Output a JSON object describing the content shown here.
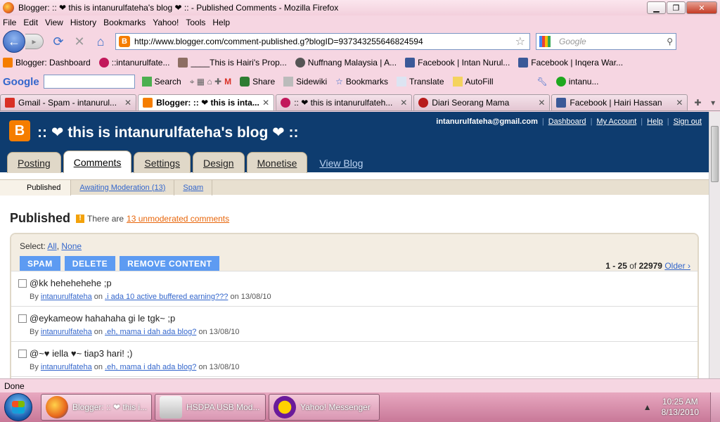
{
  "window": {
    "title": "Blogger: :: ❤ this is intanurulfateha's blog ❤ :: - Published Comments - Mozilla Firefox"
  },
  "menu": [
    "File",
    "Edit",
    "View",
    "History",
    "Bookmarks",
    "Yahoo!",
    "Tools",
    "Help"
  ],
  "nav": {
    "url": "http://www.blogger.com/comment-published.g?blogID=937343255646824594",
    "search_placeholder": "Google"
  },
  "bookmarks": [
    "Blogger: Dashboard",
    "::intanurulfate...",
    "____This is Hairi's Prop...",
    "Nuffnang Malaysia | A...",
    "Facebook | Intan Nurul...",
    "Facebook | Inqera War..."
  ],
  "gtoolbar": {
    "logo": "Google",
    "items": [
      "Search",
      "Share",
      "Sidewiki",
      "Bookmarks",
      "Translate",
      "AutoFill",
      "intanu..."
    ]
  },
  "tabs": [
    {
      "label": "Gmail - Spam - intanurul...",
      "active": false
    },
    {
      "label": "Blogger: :: ❤ this is inta...",
      "active": true
    },
    {
      "label": ":: ❤ this is intanurulfateh...",
      "active": false
    },
    {
      "label": "Diari Seorang Mama",
      "active": false
    },
    {
      "label": "Facebook | Hairi Hassan",
      "active": false
    }
  ],
  "blog": {
    "title": ":: ❤ this is intanurulfateha's blog ❤ ::",
    "email": "intanurulfateha@gmail.com",
    "links": [
      "Dashboard",
      "My Account",
      "Help",
      "Sign out"
    ],
    "main_tabs": [
      "Posting",
      "Comments",
      "Settings",
      "Design",
      "Monetise"
    ],
    "view_blog": "View Blog",
    "sub_tabs": [
      "Published",
      "Awaiting Moderation (13)",
      "Spam"
    ]
  },
  "published": {
    "heading": "Published",
    "info": "There are",
    "unmoderated_link": "13 unmoderated comments",
    "select_label": "Select:",
    "select_all": "All",
    "select_none": "None",
    "buttons": [
      "SPAM",
      "DELETE",
      "REMOVE CONTENT"
    ],
    "pager_range": "1 - 25",
    "pager_of": "of",
    "pager_total": "22979",
    "older": "Older ›",
    "comments": [
      {
        "text": "@kk hehehehehe ;p",
        "by": "By",
        "author": "intanurulfateha",
        "on": "on",
        "post": ".i ada 10 active buffered earning???",
        "date": "on 13/08/10"
      },
      {
        "text": "@eykameow hahahaha gi le tgk~ ;p",
        "by": "By",
        "author": "intanurulfateha",
        "on": "on",
        "post": ".eh, mama i dah ada blog?",
        "date": "on 13/08/10"
      },
      {
        "text": "@~♥ iella ♥~ tiap3 hari! ;)",
        "by": "By",
        "author": "intanurulfateha",
        "on": "on",
        "post": ".eh, mama i dah ada blog?",
        "date": "on 13/08/10"
      }
    ]
  },
  "status": "Done",
  "taskbar": {
    "tasks": [
      "Blogger: :: ❤ this i...",
      "HSDPA USB Mod...",
      "Yahoo! Messenger"
    ],
    "time": "10:25 AM",
    "date": "8/13/2010"
  },
  "colors": {
    "blogger_orange": "#f57d00",
    "header_blue": "#0e3c6f",
    "button_blue": "#5d9bf2",
    "link_orange": "#e8660b"
  }
}
